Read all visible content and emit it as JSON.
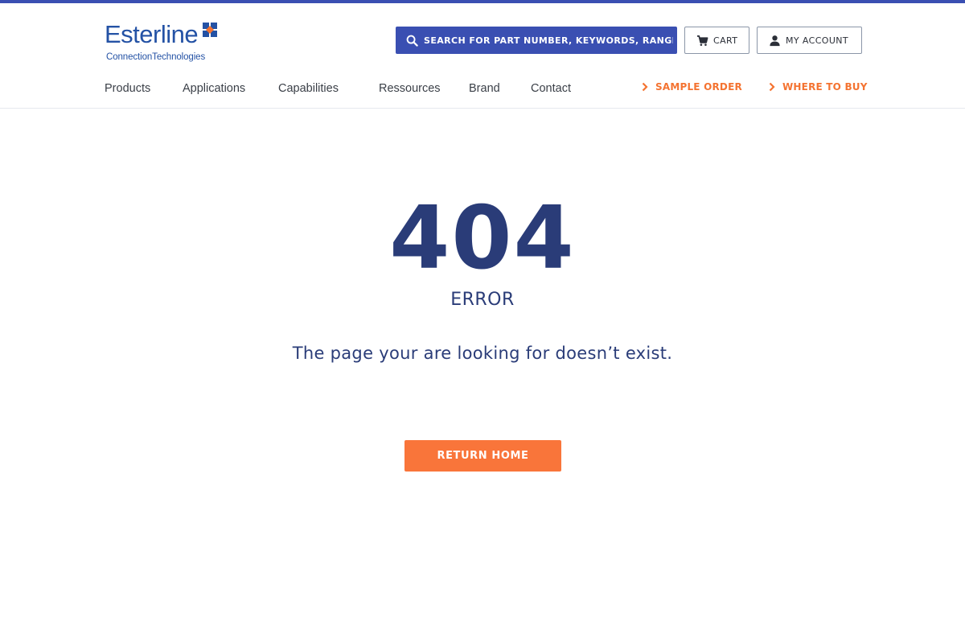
{
  "brand": {
    "name": "Esterline",
    "tagline": "ConnectionTechnologies",
    "colors": {
      "primary": "#2a3c78",
      "accent_blue": "#3a4fb2",
      "accent_orange": "#f47331"
    }
  },
  "header": {
    "search": {
      "placeholder": "SEARCH FOR PART NUMBER, KEYWORDS, RANGE",
      "icon": "search-icon"
    },
    "cart": {
      "label": "CART",
      "icon": "cart-icon"
    },
    "account": {
      "label": "MY ACCOUNT",
      "icon": "user-icon"
    }
  },
  "nav": {
    "items": [
      {
        "label": "Products"
      },
      {
        "label": "Applications"
      },
      {
        "label": "Capabilities"
      },
      {
        "label": "Ressources"
      },
      {
        "label": "Brand"
      },
      {
        "label": "Contact"
      }
    ],
    "ctas": [
      {
        "label": "SAMPLE ORDER",
        "icon": "chevron-right-icon"
      },
      {
        "label": "WHERE TO BUY",
        "icon": "chevron-right-icon"
      }
    ]
  },
  "main": {
    "code": "404",
    "error_word": "ERROR",
    "message": "The page your are looking for doesn’t exist.",
    "button_label": "RETURN HOME"
  }
}
